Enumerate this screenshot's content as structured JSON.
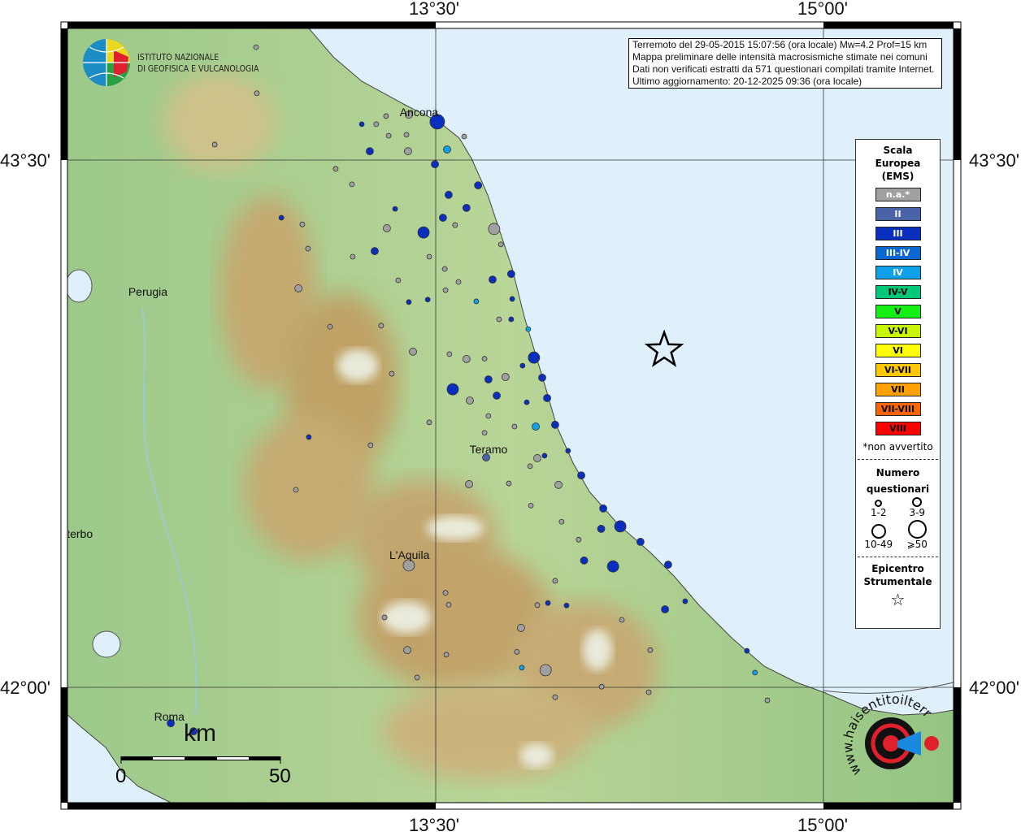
{
  "axes": {
    "lon_ticks": [
      "13°30'",
      "15°00'"
    ],
    "lat_ticks": [
      "43°30'",
      "42°00'"
    ]
  },
  "info": {
    "line1": "Terremoto del 29-05-2015 15:07:56 (ora locale) Mw=4.2 Prof=15 km",
    "line2": "Mappa preliminare delle intensità macrosismiche stimate nei comuni",
    "line3": "Dati non verificati estratti da 571 questionari compilati tramite Internet.",
    "line4": "Ultimo aggiornamento: 20-12-2025 09:36 (ora locale)"
  },
  "logo": {
    "line1": "ISTITUTO NAZIONALE",
    "line2": "DI GEOFISICA E VULCANOLOGIA"
  },
  "site_logo": {
    "text": "www.haisentitoilterremoto.it"
  },
  "legend": {
    "title1": "Scala",
    "title2": "Europea",
    "title3": "(EMS)",
    "classes": [
      {
        "label": "n.a.*",
        "color": "#a0a0a0",
        "text": "#ffffff"
      },
      {
        "label": "II",
        "color": "#4a62a8",
        "text": "#ffffff"
      },
      {
        "label": "III",
        "color": "#0a2fbf",
        "text": "#ffffff"
      },
      {
        "label": "III-IV",
        "color": "#0a66d0",
        "text": "#ffffff"
      },
      {
        "label": "IV",
        "color": "#0ea0e8",
        "text": "#ffffff"
      },
      {
        "label": "IV-V",
        "color": "#00c878",
        "text": "#000000"
      },
      {
        "label": "V",
        "color": "#14f014",
        "text": "#000000"
      },
      {
        "label": "V-VI",
        "color": "#c8f500",
        "text": "#000000"
      },
      {
        "label": "VI",
        "color": "#ffff00",
        "text": "#000000"
      },
      {
        "label": "VI-VII",
        "color": "#ffc800",
        "text": "#000000"
      },
      {
        "label": "VII",
        "color": "#ffa000",
        "text": "#000000"
      },
      {
        "label": "VII-VIII",
        "color": "#ff6400",
        "text": "#000000"
      },
      {
        "label": "VIII",
        "color": "#ff0000",
        "text": "#000000"
      }
    ],
    "na_note": "*non avvertito",
    "count_title1": "Numero",
    "count_title2": "questionari",
    "sizes": [
      "1-2",
      "3-9",
      "10-49",
      "⩾50"
    ],
    "epi_title1": "Epicentro",
    "epi_title2": "Strumentale"
  },
  "cities": [
    {
      "name": "Ancona",
      "lon": 13.43,
      "lat": 43.62
    },
    {
      "name": "Perugia",
      "lon": 12.38,
      "lat": 43.11
    },
    {
      "name": "Teramo",
      "lon": 13.7,
      "lat": 42.66
    },
    {
      "name": "L'Aquila",
      "lon": 13.39,
      "lat": 42.36
    },
    {
      "name": "Viterbo",
      "lon": 12.11,
      "lat": 42.42
    },
    {
      "name": "Roma",
      "lon": 12.48,
      "lat": 41.9
    }
  ],
  "scale_bar": {
    "unit": "km",
    "min": "0",
    "max": "50"
  },
  "epicenter": {
    "lon": 14.384,
    "lat": 42.959
  },
  "points": [
    [
      13.506,
      43.609,
      "III",
      4
    ],
    [
      13.544,
      43.53,
      "IV",
      2
    ],
    [
      13.393,
      43.525,
      "na",
      2
    ],
    [
      13.396,
      43.629,
      "na",
      2
    ],
    [
      13.245,
      43.525,
      "III",
      2
    ],
    [
      13.214,
      43.602,
      "III",
      1
    ],
    [
      13.497,
      43.488,
      "III",
      2
    ],
    [
      13.664,
      43.428,
      "III",
      2
    ],
    [
      13.55,
      43.401,
      "III",
      2
    ],
    [
      13.619,
      43.364,
      "III",
      2
    ],
    [
      13.528,
      43.336,
      "III",
      2
    ],
    [
      13.453,
      43.294,
      "III",
      3
    ],
    [
      13.726,
      43.304,
      "na",
      3
    ],
    [
      13.311,
      43.306,
      "na",
      2
    ],
    [
      13.264,
      43.241,
      "III",
      2
    ],
    [
      13.343,
      43.361,
      "III",
      1
    ],
    [
      13.792,
      43.176,
      "III",
      2
    ],
    [
      13.72,
      43.16,
      "III",
      2
    ],
    [
      12.969,
      43.135,
      "na",
      2
    ],
    [
      13.396,
      43.096,
      "III",
      1
    ],
    [
      13.469,
      43.103,
      "III",
      1
    ],
    [
      13.796,
      43.105,
      "III",
      1
    ],
    [
      13.657,
      43.098,
      "IV",
      1
    ],
    [
      13.792,
      43.047,
      "III",
      1
    ],
    [
      13.858,
      43.019,
      "IV",
      1
    ],
    [
      13.88,
      42.938,
      "III",
      3
    ],
    [
      13.912,
      42.881,
      "III",
      2
    ],
    [
      13.836,
      42.915,
      "III",
      1
    ],
    [
      13.704,
      42.876,
      "III",
      2
    ],
    [
      13.566,
      42.848,
      "III",
      3
    ],
    [
      13.736,
      42.83,
      "III",
      2
    ],
    [
      13.931,
      42.823,
      "III",
      2
    ],
    [
      13.852,
      42.811,
      "III",
      1
    ],
    [
      13.962,
      42.747,
      "III",
      2
    ],
    [
      13.887,
      42.742,
      "IV",
      2
    ],
    [
      13.632,
      42.816,
      "na",
      2
    ],
    [
      13.619,
      42.934,
      "na",
      2
    ],
    [
      13.77,
      42.883,
      "na",
      2
    ],
    [
      13.412,
      42.955,
      "na",
      2
    ],
    [
      13.695,
      42.654,
      "II",
      2
    ],
    [
      13.893,
      42.652,
      "na",
      2
    ],
    [
      13.921,
      42.659,
      "III",
      1
    ],
    [
      14.012,
      42.673,
      "III",
      1
    ],
    [
      14.063,
      42.603,
      "III",
      2
    ],
    [
      13.975,
      42.576,
      "na",
      2
    ],
    [
      13.629,
      42.578,
      "na",
      2
    ],
    [
      14.148,
      42.509,
      "III",
      2
    ],
    [
      14.214,
      42.458,
      "III",
      3
    ],
    [
      14.14,
      42.451,
      "III",
      2
    ],
    [
      14.292,
      42.414,
      "III",
      2
    ],
    [
      14.074,
      42.361,
      "III",
      2
    ],
    [
      14.186,
      42.344,
      "III",
      3
    ],
    [
      14.399,
      42.349,
      "III",
      2
    ],
    [
      14.387,
      42.222,
      "III",
      2
    ],
    [
      14.465,
      42.245,
      "III",
      1
    ],
    [
      14.704,
      42.104,
      "III",
      1
    ],
    [
      14.735,
      42.042,
      "IV",
      1
    ],
    [
      13.396,
      42.347,
      "na",
      3
    ],
    [
      13.39,
      42.106,
      "na",
      2
    ],
    [
      13.925,
      42.049,
      "na",
      3
    ],
    [
      13.83,
      42.169,
      "na",
      2
    ],
    [
      13.833,
      42.056,
      "IV",
      1
    ],
    [
      13.934,
      42.24,
      "III",
      1
    ],
    [
      14.006,
      42.233,
      "III",
      1
    ],
    [
      13.009,
      42.712,
      "III",
      1
    ],
    [
      12.903,
      43.336,
      "III",
      1
    ],
    [
      12.475,
      41.898,
      "III",
      2
    ],
    [
      12.563,
      41.875,
      "III",
      2
    ],
    [
      14.783,
      41.963,
      "na",
      1
    ],
    [
      12.805,
      43.821,
      "na",
      1
    ],
    [
      12.808,
      43.69,
      "na",
      1
    ],
    [
      12.645,
      43.544,
      "na",
      1
    ],
    [
      13.113,
      43.475,
      "na",
      1
    ],
    [
      13.176,
      43.431,
      "na",
      1
    ],
    [
      12.984,
      43.317,
      "na",
      1
    ],
    [
      13.006,
      43.248,
      "na",
      1
    ],
    [
      13.179,
      43.225,
      "na",
      1
    ],
    [
      13.355,
      43.158,
      "na",
      1
    ],
    [
      13.538,
      43.13,
      "na",
      1
    ],
    [
      13.289,
      43.029,
      "na",
      1
    ],
    [
      13.091,
      43.026,
      "na",
      1
    ],
    [
      13.553,
      42.948,
      "na",
      1
    ],
    [
      13.33,
      42.892,
      "na",
      1
    ],
    [
      13.475,
      42.754,
      "na",
      1
    ],
    [
      13.248,
      42.689,
      "na",
      1
    ],
    [
      12.959,
      42.562,
      "na",
      1
    ],
    [
      13.302,
      42.199,
      "na",
      1
    ],
    [
      13.428,
      42.028,
      "na",
      1
    ],
    [
      13.541,
      42.093,
      "na",
      1
    ],
    [
      13.814,
      42.101,
      "na",
      1
    ],
    [
      14.142,
      42.002,
      "na",
      1
    ],
    [
      14.324,
      41.986,
      "na",
      1
    ],
    [
      14.22,
      42.192,
      "na",
      1
    ],
    [
      14.33,
      42.106,
      "na",
      1
    ],
    [
      13.962,
      41.972,
      "na",
      1
    ],
    [
      13.308,
      43.625,
      "na",
      1
    ],
    [
      13.27,
      43.602,
      "na",
      1
    ],
    [
      13.318,
      43.569,
      "na",
      1
    ],
    [
      13.387,
      43.572,
      "na",
      1
    ],
    [
      13.61,
      43.567,
      "na",
      1
    ],
    [
      13.575,
      43.315,
      "na",
      1
    ],
    [
      13.475,
      43.225,
      "na",
      1
    ],
    [
      13.535,
      43.19,
      "na",
      1
    ],
    [
      13.588,
      43.153,
      "na",
      1
    ],
    [
      13.752,
      43.26,
      "na",
      1
    ],
    [
      13.745,
      43.047,
      "na",
      1
    ],
    [
      13.689,
      42.935,
      "na",
      1
    ],
    [
      13.805,
      42.742,
      "na",
      1
    ],
    [
      13.689,
      42.724,
      "na",
      1
    ],
    [
      13.704,
      42.772,
      "na",
      1
    ],
    [
      13.865,
      42.629,
      "na",
      1
    ],
    [
      13.783,
      42.58,
      "na",
      1
    ],
    [
      13.868,
      42.517,
      "na",
      1
    ],
    [
      13.987,
      42.471,
      "na",
      1
    ],
    [
      14.053,
      42.42,
      "na",
      1
    ],
    [
      13.962,
      42.303,
      "na",
      1
    ],
    [
      13.893,
      42.234,
      "na",
      1
    ],
    [
      13.538,
      42.269,
      "na",
      1
    ],
    [
      13.55,
      42.235,
      "na",
      1
    ]
  ]
}
